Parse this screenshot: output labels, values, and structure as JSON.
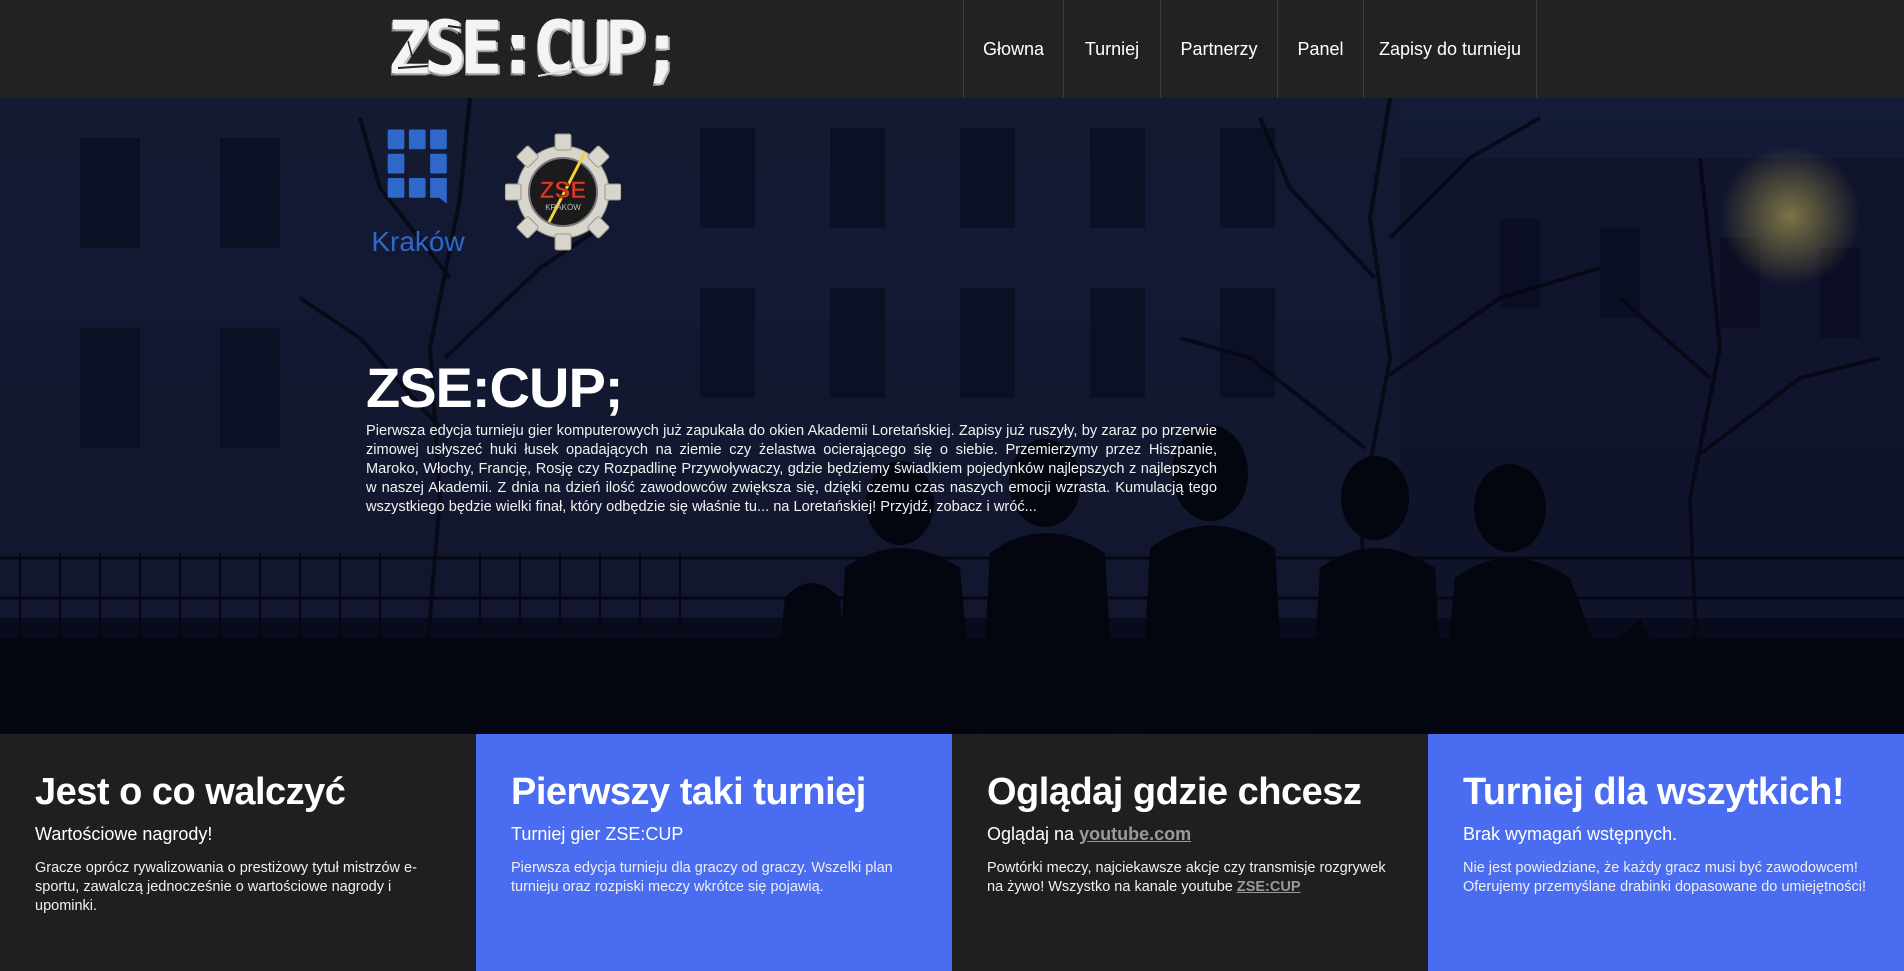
{
  "header": {
    "logo_text": "ZSE:CUP;",
    "nav": [
      {
        "label": "Głowna"
      },
      {
        "label": "Turniej"
      },
      {
        "label": "Partnerzy"
      },
      {
        "label": "Panel"
      },
      {
        "label": "Zapisy do turnieju"
      }
    ]
  },
  "hero": {
    "partner_logos": {
      "krakow_label": "Kraków",
      "zse_badge_text": "ZSE",
      "zse_badge_sub": "KRAKÓW"
    },
    "title": "ZSE:CUP;",
    "text": "Pierwsza edycja turnieju gier komputerowych już zapukała do okien Akademii Loretańskiej. Zapisy już ruszyły, by zaraz po przerwie zimowej usłyszeć huki łusek opadających na ziemie czy żelastwa ocierającego się o siebie. Przemierzymy przez Hiszpanie, Maroko, Włochy, Francję, Rosję czy Rozpadlinę Przywoływaczy, gdzie będziemy świadkiem pojedynków najlepszych z najlepszych w naszej Akademii. Z dnia na dzień ilość zawodowców zwiększa się, dzięki czemu czas naszych emocji wzrasta. Kumulacją tego wszystkiego będzie wielki finał, który odbędzie się właśnie tu... na Loretańskiej! Przyjdź, zobacz i wróć..."
  },
  "features": [
    {
      "title": "Jest o co walczyć",
      "subtitle": "Wartościowe nagrody!",
      "text": "Gracze oprócz rywalizowania o prestiżowy tytuł mistrzów e-sportu, zawalczą jednocześnie o wartościowe nagrody i upominki."
    },
    {
      "title": "Pierwszy taki turniej",
      "subtitle": "Turniej gier ZSE:CUP",
      "text": "Pierwsza edycja turnieju dla graczy od graczy. Wszelki plan turnieju oraz rozpiski meczy wkrótce się pojawią."
    },
    {
      "title": "Oglądaj gdzie chcesz",
      "subtitle_prefix": "Oglądaj na ",
      "subtitle_link": "youtube.com",
      "text": "Powtórki meczy, najciekawsze akcje czy transmisje rozgrywek na żywo! Wszystko na kanale youtube ",
      "text_link": "ZSE:CUP"
    },
    {
      "title": "Turniej dla wszytkich!",
      "subtitle": "Brak wymagań wstępnych.",
      "text": "Nie jest powiedziane, że każdy gracz musi być zawodowcem! Oferujemy przemyślane drabinki dopasowane do umiejętności!"
    }
  ],
  "colors": {
    "header_bg": "#222222",
    "accent_blue": "#4a6cf0",
    "dark_box": "#1f1f1f",
    "krakow_blue": "#2f68c9",
    "link_gray": "#9a9a9a"
  }
}
